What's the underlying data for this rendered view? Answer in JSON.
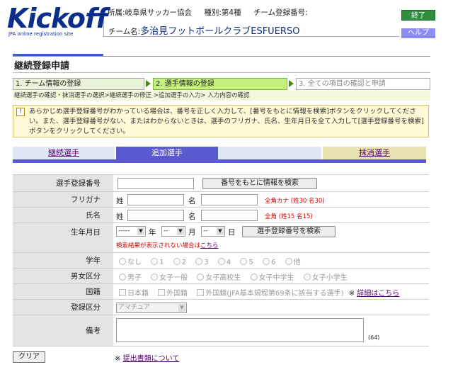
{
  "header": {
    "logo_text": "Kickoff",
    "logo_sub": "JFA online registration site",
    "association": "所属:岐阜県サッカー協会",
    "category": "種別:第4種",
    "team_reg_no_label": "チーム登録番号:",
    "team_name_label": "チーム名:",
    "team_name": "多治見フットボールクラブESFUERSO",
    "end_button": "終了",
    "help_button": "ヘルプ"
  },
  "page": {
    "title": "継続登録申請"
  },
  "steps": [
    {
      "label": "1. チーム情報の登録"
    },
    {
      "label": "2. 選手情報の登録"
    },
    {
      "label": "3. 全ての項目の確認と申請"
    }
  ],
  "substeps": "継続選手の確認・抹消選手の選択>継続選手の修正 >追加選手の入力> 入力内容の確認",
  "notice": {
    "icon": "!",
    "text": "あらかじめ選手登録番号がわかっている場合は、番号を正しく入力して、[番号をもとに情報を検索]ボタンをクリックしてください。また、選手登録番号がない、またはわからないときは、選手のフリガナ、氏名、生年月日を全て入力して[選手登録番号を検索]ボタンをクリックしてください。"
  },
  "tabs": {
    "continuing": "継続選手",
    "add": "追加選手",
    "remove": "抹消選手"
  },
  "form": {
    "player_no_label": "選手登録番号",
    "search_by_no_button": "番号をもとに情報を検索",
    "furigana_label": "フリガナ",
    "sei": "姓",
    "mei": "名",
    "furigana_hint": "全角カナ (姓30 名30)",
    "name_label": "氏名",
    "name_hint": "全角 (姓15 名15)",
    "birth_label": "生年月日",
    "year_value": "-----",
    "year_unit": "年",
    "month_value": "--",
    "month_unit": "月",
    "day_value": "--",
    "day_unit": "日",
    "search_reg_no_button": "選手登録番号を検索",
    "not_found_text": "検索結果が表示されない場合は",
    "not_found_link": "こちら",
    "grade_label": "学年",
    "grade_options": [
      "なし",
      "1",
      "2",
      "3",
      "4",
      "5",
      "6",
      "他"
    ],
    "gender_label": "男女区分",
    "gender_options": [
      "男子",
      "女子一般",
      "女子高校生",
      "女子中学生",
      "女子小学生"
    ],
    "nationality_label": "国籍",
    "nationality_options": [
      "日本籍",
      "外国籍",
      "外国籍(JFA基本規程第69条に該当する選手)"
    ],
    "nationality_note": "※",
    "nationality_link": "詳細はこちら",
    "reg_type_label": "登録区分",
    "reg_type_value": "アマチュア",
    "remarks_label": "備考",
    "remarks_count": "(64)"
  },
  "footer": {
    "clear_button": "クリア",
    "note_mark": "※",
    "docs_link": "提出書類について"
  }
}
